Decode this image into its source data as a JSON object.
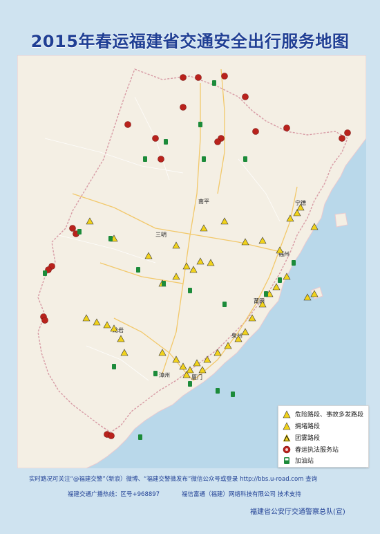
{
  "title": "2015年春运福建省交通安全出行服务地图",
  "cities": [
    {
      "name": "南平"
    },
    {
      "name": "宁德"
    },
    {
      "name": "三明"
    },
    {
      "name": "福州"
    },
    {
      "name": "莆田"
    },
    {
      "name": "龙岩"
    },
    {
      "name": "泉州"
    },
    {
      "name": "漳州"
    },
    {
      "name": "厦门"
    }
  ],
  "legend": {
    "items": [
      {
        "label": "危险路段、事故多发路段",
        "icon": "triangle-warning-icon",
        "color": "#f1d21b"
      },
      {
        "label": "拥堵路段",
        "icon": "triangle-warning-icon",
        "color": "#f1d21b"
      },
      {
        "label": "团雾路段",
        "icon": "triangle-warning-black-icon",
        "color": "#111111"
      },
      {
        "label": "春运执法服务站",
        "icon": "police-station-icon",
        "color": "#b9221c"
      },
      {
        "label": "加油站",
        "icon": "gas-station-icon",
        "color": "#1c8b3a"
      }
    ]
  },
  "footer": {
    "line1": "实时路况可关注“@福建交警”（新浪）微博、“福建交警微发布”微信公众号或登录 http://bbs.u-road.com 查询",
    "line2": "福建交通广播热线：区号+968897",
    "line2b": "福信富通（福建）网络科技有限公司   技术支持",
    "line3": "福建省公安厅交通警察总队(宣)"
  },
  "colors": {
    "title": "#1f3f94",
    "land": "#f4efe4",
    "sea": "#b9d8ea",
    "warning": "#f1d21b",
    "station": "#b9221c",
    "gas": "#1c8b3a"
  }
}
